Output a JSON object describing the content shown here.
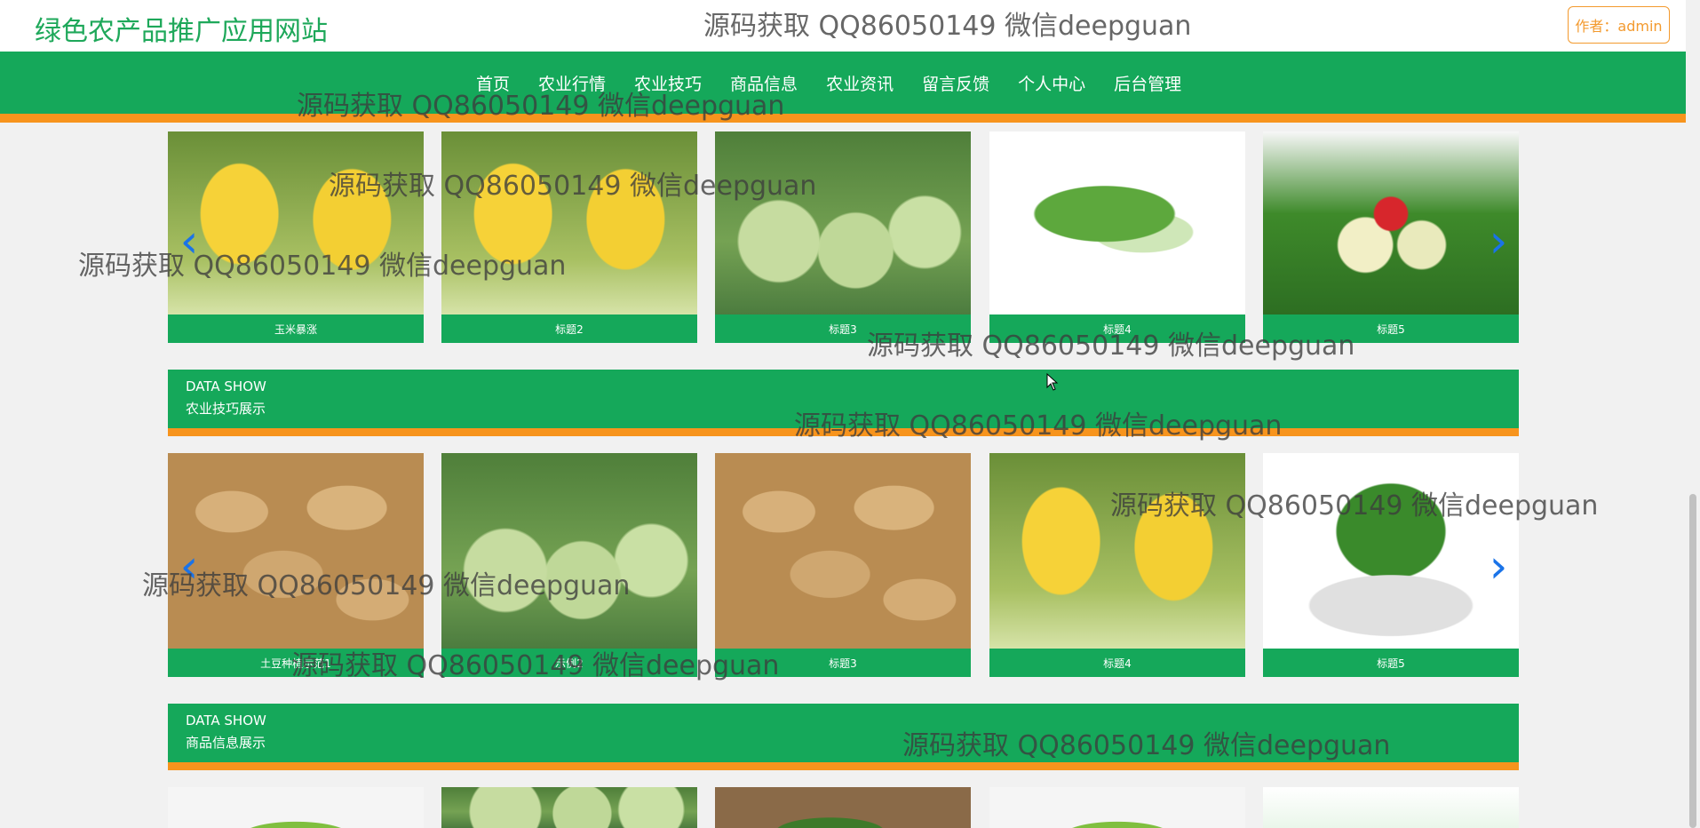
{
  "header": {
    "site_title": "绿色农产品推广应用网站",
    "author_button": "作者：admin"
  },
  "nav": {
    "items": [
      "首页",
      "农业行情",
      "农业技巧",
      "商品信息",
      "农业资讯",
      "留言反馈",
      "个人中心",
      "后台管理"
    ]
  },
  "market_carousel": {
    "items": [
      {
        "caption": "玉米暴涨",
        "image": "corn"
      },
      {
        "caption": "标题2",
        "image": "corn"
      },
      {
        "caption": "标题3",
        "image": "gourd"
      },
      {
        "caption": "标题4",
        "image": "bitter-gourd"
      },
      {
        "caption": "标题5",
        "image": "vegetables"
      }
    ]
  },
  "tips_section": {
    "en": "DATA SHOW",
    "zh": "农业技巧展示"
  },
  "tips_carousel": {
    "items": [
      {
        "caption": "土豆种植示范1",
        "image": "potato"
      },
      {
        "caption": "示例2",
        "image": "gourd"
      },
      {
        "caption": "标题3",
        "image": "potato"
      },
      {
        "caption": "标题4",
        "image": "corn"
      },
      {
        "caption": "标题5",
        "image": "bok-choy"
      }
    ]
  },
  "goods_section": {
    "en": "DATA SHOW",
    "zh": "商品信息展示"
  },
  "icons": {
    "prev": "chevron-left-icon",
    "next": "chevron-right-icon"
  },
  "watermark": {
    "text": "源码获取 QQ86050149 微信deepguan"
  },
  "colors": {
    "brand_green": "#15a85a",
    "accent_orange": "#f7941d",
    "arrow_blue": "#1a73e8"
  }
}
